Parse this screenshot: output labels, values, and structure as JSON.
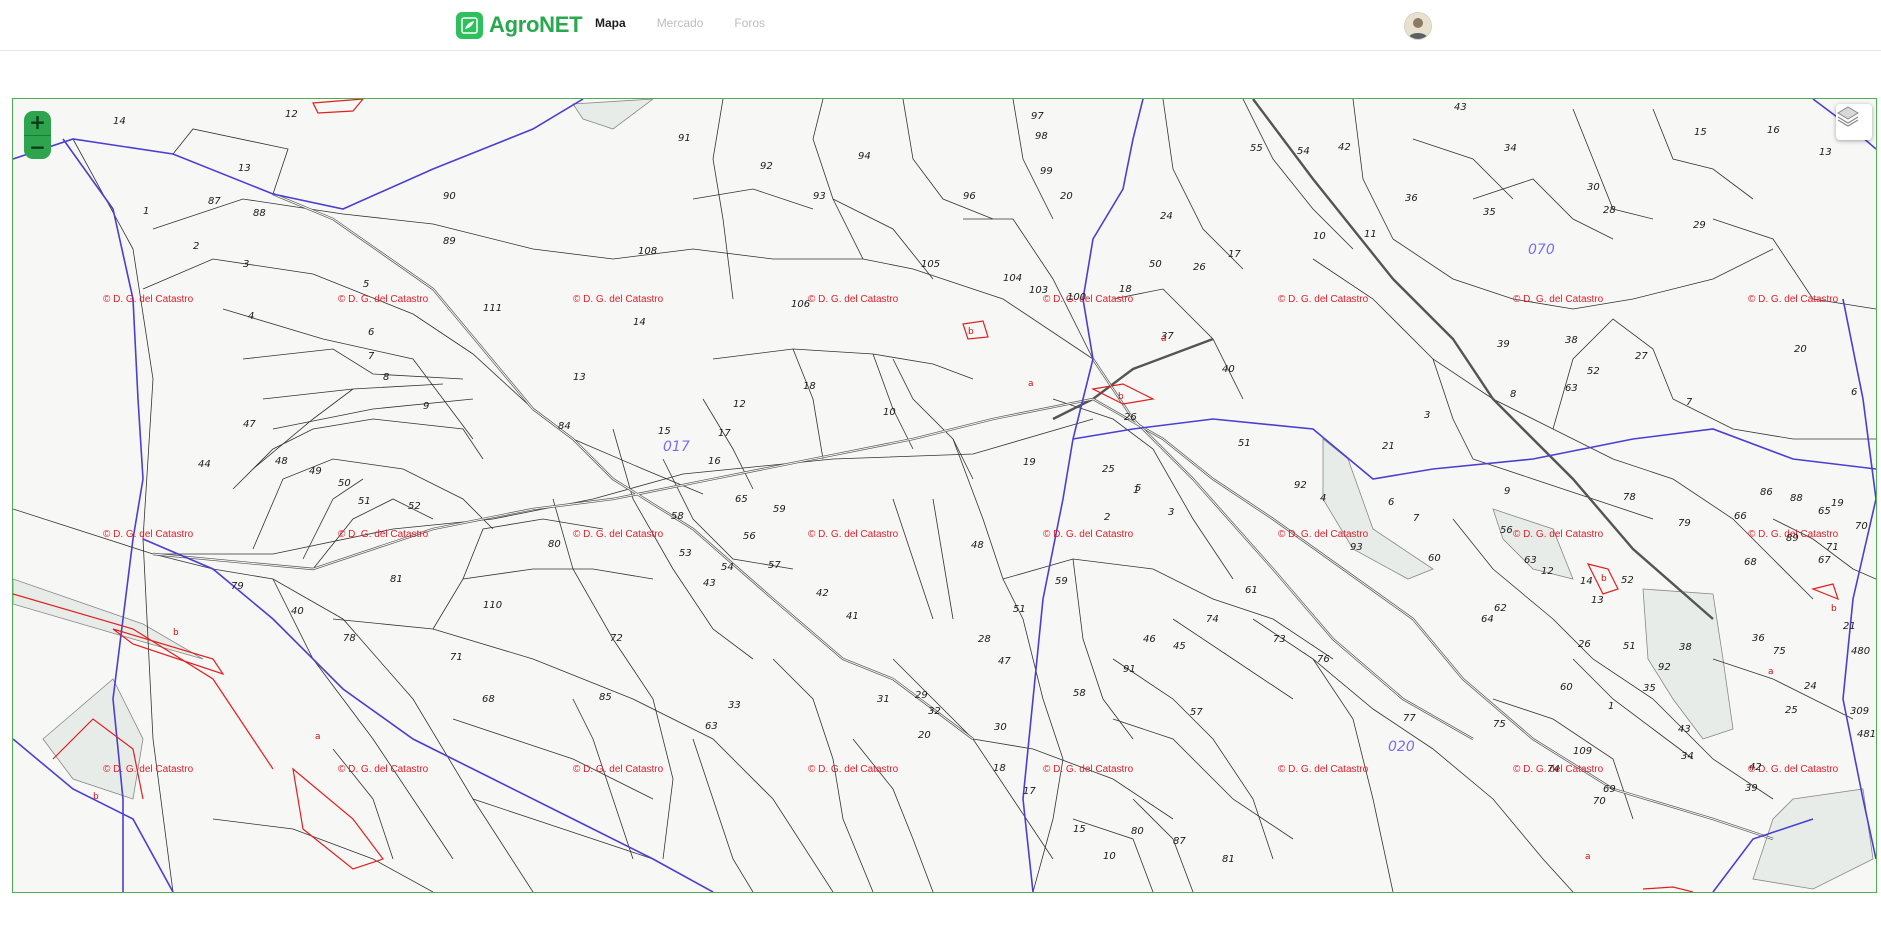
{
  "app": {
    "name": "AgroNET"
  },
  "nav": {
    "items": [
      {
        "label": "Mapa",
        "active": true
      },
      {
        "label": "Mercado",
        "active": false
      },
      {
        "label": "Foros",
        "active": false
      }
    ]
  },
  "map": {
    "zoom_in_label": "+",
    "zoom_out_label": "−",
    "watermark": "© D. G. del Catastro",
    "polygon_labels": [
      "017",
      "070",
      "020"
    ],
    "parcel_numbers": [
      "14",
      "12",
      "13",
      "1",
      "87",
      "88",
      "2",
      "3",
      "4",
      "5",
      "6",
      "7",
      "8",
      "9",
      "47",
      "44",
      "48",
      "49",
      "50",
      "51",
      "52",
      "91",
      "92",
      "94",
      "93",
      "96",
      "97",
      "98",
      "99",
      "90",
      "89",
      "108",
      "105",
      "104",
      "103",
      "100",
      "106",
      "111",
      "14",
      "13",
      "84",
      "15",
      "17",
      "16",
      "12",
      "10",
      "18",
      "19",
      "20",
      "24",
      "26",
      "50",
      "55",
      "54",
      "42",
      "43",
      "34",
      "30",
      "15",
      "16",
      "13",
      "10",
      "11",
      "36",
      "35",
      "28",
      "29",
      "17",
      "18",
      "37",
      "40",
      "39",
      "38",
      "63",
      "52",
      "27",
      "20",
      "6",
      "8",
      "7",
      "3",
      "21",
      "51",
      "26",
      "25",
      "5",
      "1",
      "2",
      "3",
      "4",
      "6",
      "7",
      "9",
      "78",
      "79",
      "86",
      "88",
      "89",
      "92",
      "93",
      "56",
      "63",
      "12",
      "14",
      "13",
      "62",
      "64",
      "60",
      "61",
      "65",
      "59",
      "56",
      "57",
      "58",
      "53",
      "54",
      "43",
      "42",
      "41",
      "80",
      "81",
      "79",
      "40",
      "78",
      "110",
      "72",
      "71",
      "68",
      "85",
      "33",
      "63",
      "31",
      "32",
      "30",
      "29",
      "28",
      "51",
      "47",
      "48",
      "59",
      "46",
      "45",
      "91",
      "58",
      "57",
      "74",
      "73",
      "76",
      "77",
      "75",
      "74",
      "70",
      "109",
      "69",
      "35",
      "34",
      "39",
      "42",
      "43",
      "38",
      "36",
      "52",
      "51",
      "92",
      "1",
      "60",
      "26",
      "75",
      "25",
      "24",
      "309",
      "481",
      "480",
      "67",
      "68",
      "66",
      "65",
      "70",
      "71",
      "19",
      "21",
      "20",
      "18",
      "17",
      "15",
      "80",
      "81",
      "87",
      "10"
    ],
    "sub_letters": [
      "a",
      "b",
      "a",
      "b",
      "c",
      "b",
      "a",
      "a",
      "b",
      "a",
      "b"
    ]
  },
  "colors": {
    "brand": "#2fbf5c",
    "border": "#4caf50",
    "road": "#4a3fd0",
    "parcel_line": "#333333",
    "watermark": "#e0202b"
  },
  "icons": {
    "logo": "leaf-grid-icon",
    "layers": "layers-icon",
    "avatar": "user-avatar"
  }
}
